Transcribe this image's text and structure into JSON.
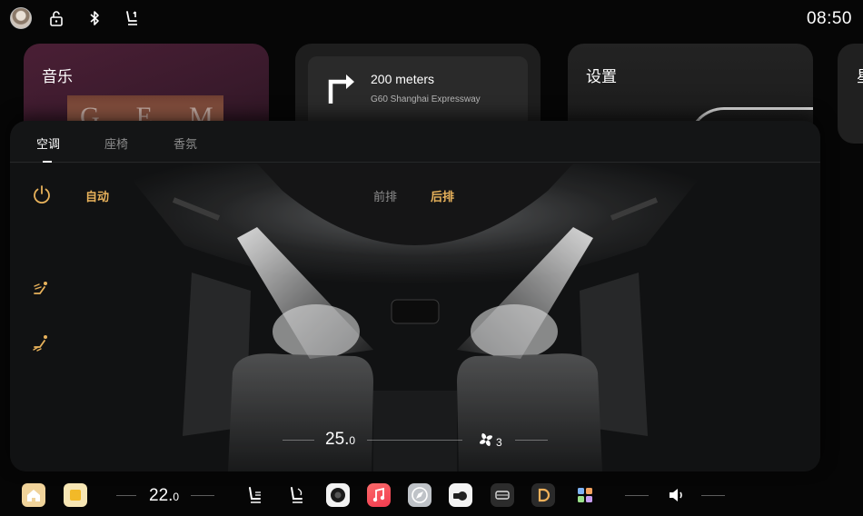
{
  "status_bar": {
    "time": "08:50",
    "icons": [
      "avatar",
      "unlock-icon",
      "bluetooth-icon",
      "seat-1-icon"
    ]
  },
  "cards": {
    "music": {
      "title": "音乐",
      "album_text": "GEM"
    },
    "navigation": {
      "distance": "200 meters",
      "road": "G60 Shanghai Expressway",
      "icon": "turn-right-arrow-icon"
    },
    "settings": {
      "title": "设置"
    },
    "partial": {
      "title": "星"
    }
  },
  "climate": {
    "tabs": [
      {
        "label": "空调",
        "active": true
      },
      {
        "label": "座椅",
        "active": false
      },
      {
        "label": "香氛",
        "active": false
      }
    ],
    "auto_label": "自动",
    "zone_front": "前排",
    "zone_rear": "后排",
    "zone_selected": "后排",
    "accent_color": "#e8b25b",
    "temperature_whole": "25.",
    "temperature_decimal": "0",
    "fan_level": "3"
  },
  "dock": {
    "temperature_whole": "22.",
    "temperature_decimal": "0",
    "apps": [
      "home-icon",
      "notes-icon",
      "driver-seat-icon",
      "passenger-seat-icon",
      "camera-icon",
      "music-app-icon",
      "safari-icon",
      "car-camera-icon",
      "car-front-icon",
      "d-icon",
      "apps-grid-icon",
      "volume-icon"
    ]
  }
}
